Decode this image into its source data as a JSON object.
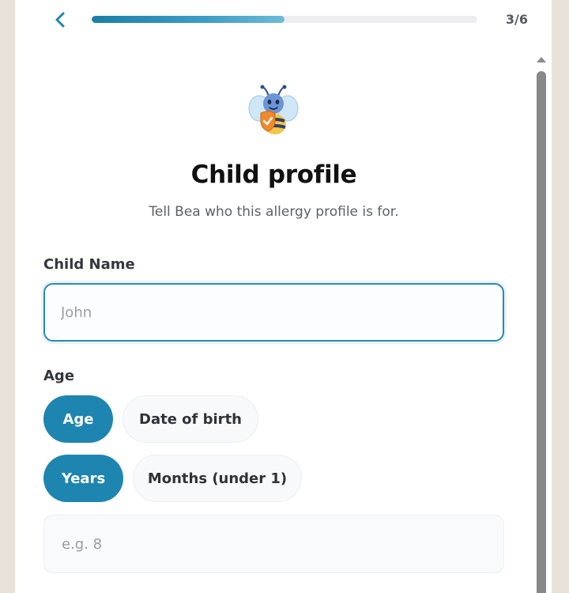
{
  "header": {
    "back_icon": "chevron-left-icon",
    "progress": 0.5,
    "step": "3/6"
  },
  "mascot": {
    "icon": "bee-shield-mascot-icon"
  },
  "page": {
    "title": "Child profile",
    "subtitle": "Tell Bea who this allergy profile is for."
  },
  "child_name": {
    "label": "Child Name",
    "placeholder": "John",
    "value": ""
  },
  "age": {
    "label": "Age",
    "mode_options": [
      {
        "label": "Age",
        "selected": true
      },
      {
        "label": "Date of birth",
        "selected": false
      }
    ],
    "unit_options": [
      {
        "label": "Years",
        "selected": true
      },
      {
        "label": "Months (under 1)",
        "selected": false
      }
    ],
    "placeholder": "e.g. 8",
    "value": ""
  },
  "colors": {
    "accent": "#1e85b0",
    "background": "#e9e2db",
    "panel": "#ffffff"
  }
}
